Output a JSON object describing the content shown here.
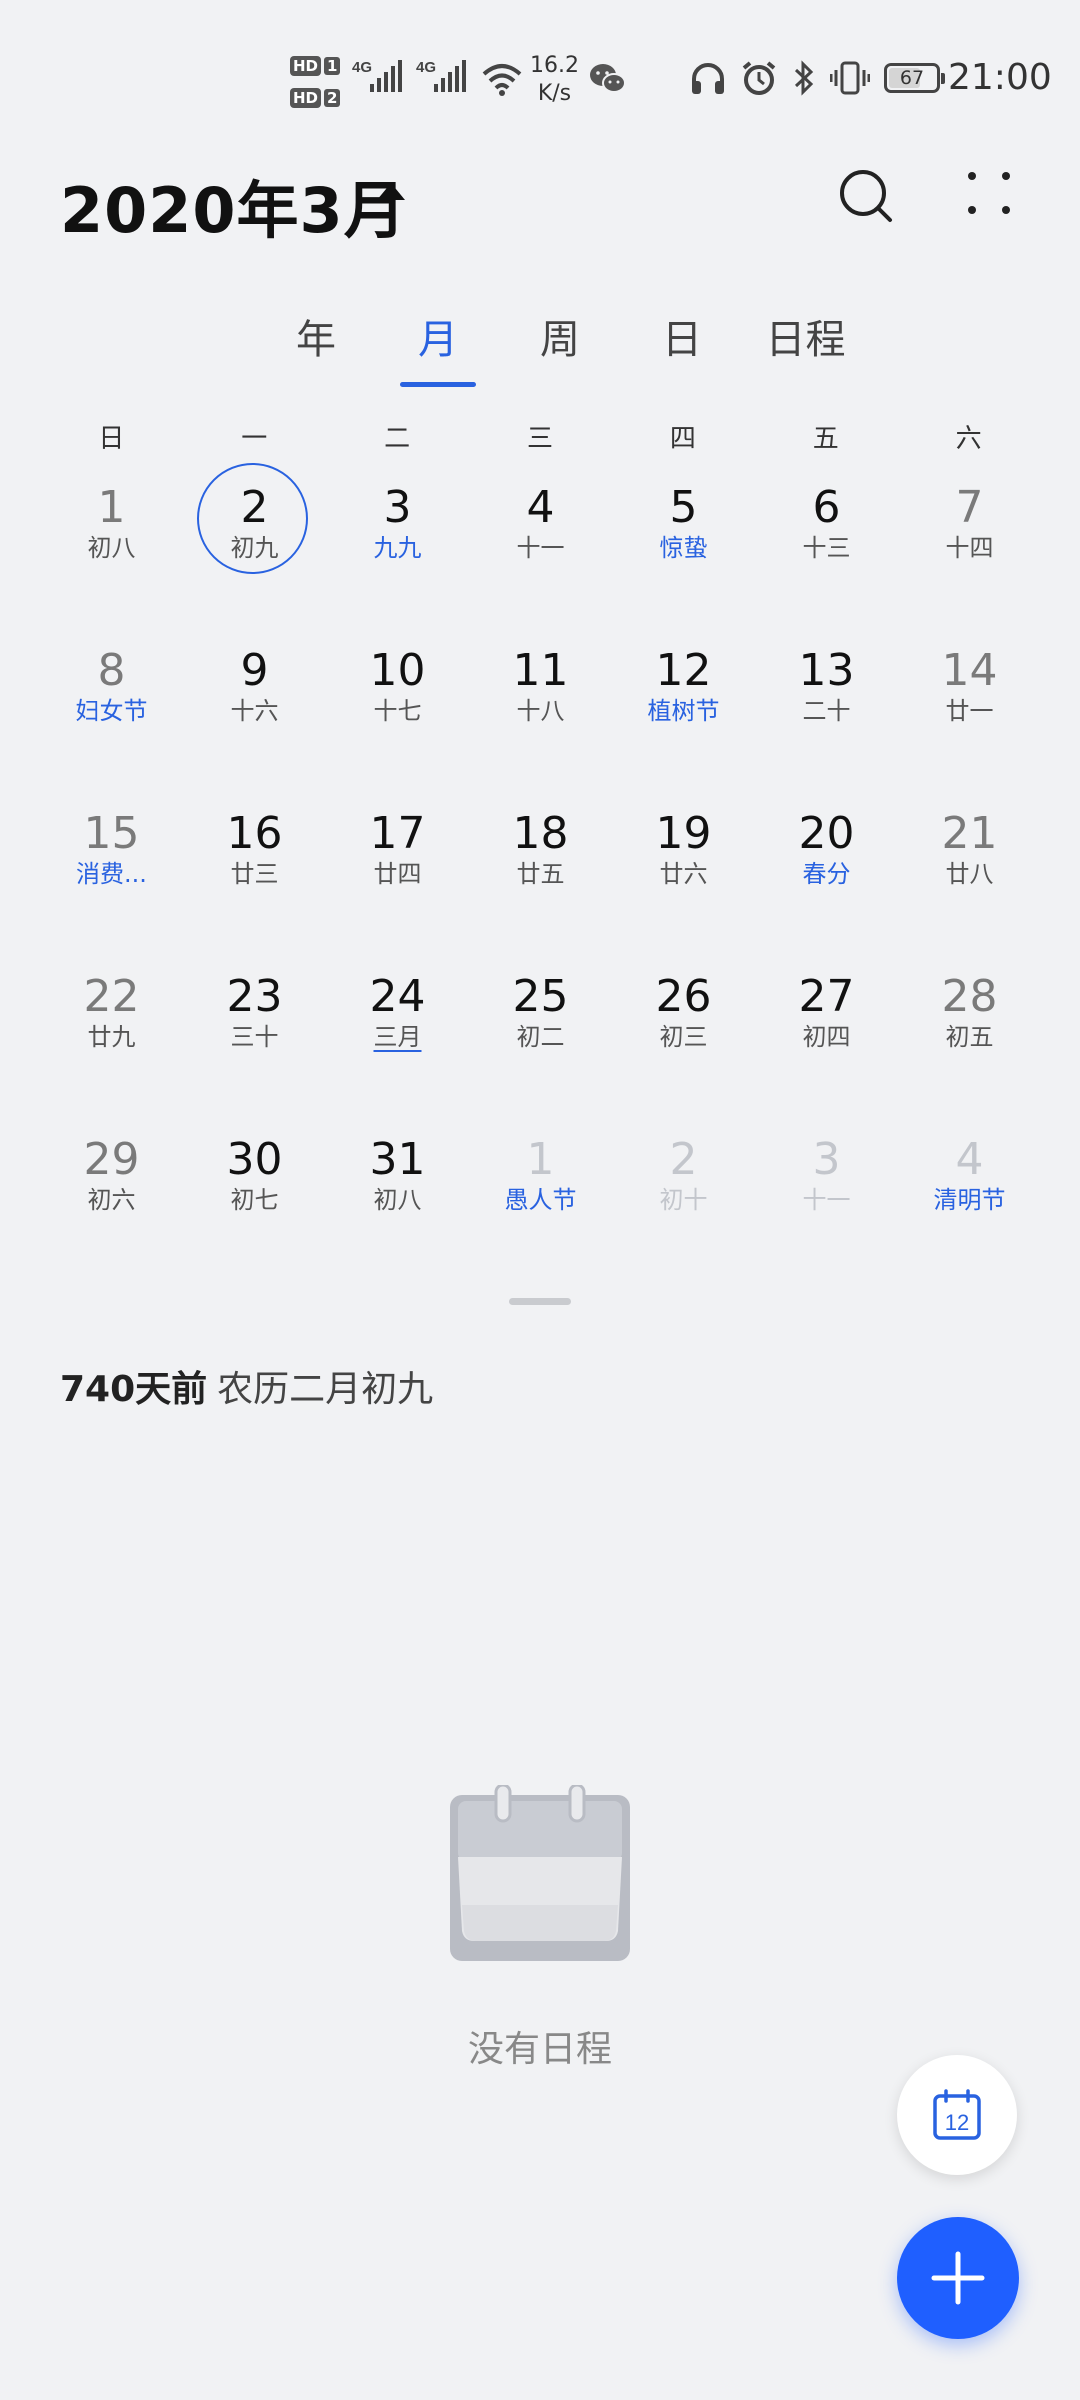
{
  "status_bar": {
    "hd1": "HD",
    "sim1": "1",
    "hd2": "HD",
    "sim2": "2",
    "net1": "4G",
    "net2": "4G",
    "speed_value": "16.2",
    "speed_unit": "K/s",
    "battery": "67",
    "time": "21:00",
    "icons": [
      "wechat-icon",
      "headphones-icon",
      "alarm-icon",
      "bluetooth-icon",
      "vibrate-icon"
    ]
  },
  "header": {
    "title": "2020年3月",
    "icons": [
      "triangle-up-icon",
      "search-icon",
      "more-icon"
    ]
  },
  "tabs": [
    {
      "label": "年",
      "active": false
    },
    {
      "label": "月",
      "active": true
    },
    {
      "label": "周",
      "active": false
    },
    {
      "label": "日",
      "active": false
    },
    {
      "label": "日程",
      "active": false
    }
  ],
  "weekdays": [
    "日",
    "一",
    "二",
    "三",
    "四",
    "五",
    "六"
  ],
  "calendar": {
    "weeks": [
      [
        {
          "day": "1",
          "lunar": "初八"
        },
        {
          "day": "2",
          "lunar": "初九",
          "selected": true
        },
        {
          "day": "3",
          "lunar": "九九",
          "highlight": true
        },
        {
          "day": "4",
          "lunar": "十一"
        },
        {
          "day": "5",
          "lunar": "惊蛰",
          "highlight": true
        },
        {
          "day": "6",
          "lunar": "十三"
        },
        {
          "day": "7",
          "lunar": "十四"
        }
      ],
      [
        {
          "day": "8",
          "lunar": "妇女节",
          "highlight": true
        },
        {
          "day": "9",
          "lunar": "十六"
        },
        {
          "day": "10",
          "lunar": "十七"
        },
        {
          "day": "11",
          "lunar": "十八"
        },
        {
          "day": "12",
          "lunar": "植树节",
          "highlight": true
        },
        {
          "day": "13",
          "lunar": "二十"
        },
        {
          "day": "14",
          "lunar": "廿一"
        }
      ],
      [
        {
          "day": "15",
          "lunar": "消费...",
          "highlight": true
        },
        {
          "day": "16",
          "lunar": "廿三"
        },
        {
          "day": "17",
          "lunar": "廿四"
        },
        {
          "day": "18",
          "lunar": "廿五"
        },
        {
          "day": "19",
          "lunar": "廿六"
        },
        {
          "day": "20",
          "lunar": "春分",
          "highlight": true
        },
        {
          "day": "21",
          "lunar": "廿八"
        }
      ],
      [
        {
          "day": "22",
          "lunar": "廿九"
        },
        {
          "day": "23",
          "lunar": "三十"
        },
        {
          "day": "24",
          "lunar": "三月",
          "underline": true
        },
        {
          "day": "25",
          "lunar": "初二"
        },
        {
          "day": "26",
          "lunar": "初三"
        },
        {
          "day": "27",
          "lunar": "初四"
        },
        {
          "day": "28",
          "lunar": "初五"
        }
      ],
      [
        {
          "day": "29",
          "lunar": "初六"
        },
        {
          "day": "30",
          "lunar": "初七"
        },
        {
          "day": "31",
          "lunar": "初八"
        },
        {
          "day": "1",
          "lunar": "愚人节",
          "other_month": true,
          "highlight": true
        },
        {
          "day": "2",
          "lunar": "初十",
          "other_month": true
        },
        {
          "day": "3",
          "lunar": "十一",
          "other_month": true
        },
        {
          "day": "4",
          "lunar": "清明节",
          "other_month": true,
          "highlight": true
        }
      ]
    ]
  },
  "date_info": {
    "relative": "740天前",
    "lunar": "农历二月初九"
  },
  "empty_state": {
    "text": "没有日程",
    "icon": "calendar-empty-icon"
  },
  "fab": {
    "today_label": "12",
    "today_icon": "calendar-today-icon",
    "add_icon": "plus-icon"
  },
  "colors": {
    "accent": "#2962e0",
    "fab": "#1f5fff",
    "background": "#f1f2f4"
  }
}
